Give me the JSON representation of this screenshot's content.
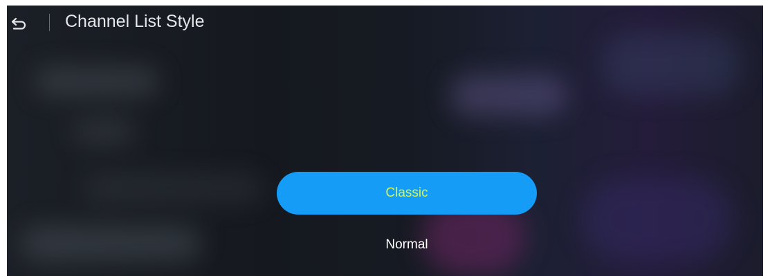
{
  "header": {
    "back_icon": "back-arrow-icon",
    "title": "Channel List Style"
  },
  "options": [
    {
      "label": "Classic",
      "selected": true
    },
    {
      "label": "Normal",
      "selected": false
    }
  ],
  "colors": {
    "selected_background": "#149cf7",
    "selected_text": "#d6f54a",
    "normal_text": "#ffffff"
  }
}
